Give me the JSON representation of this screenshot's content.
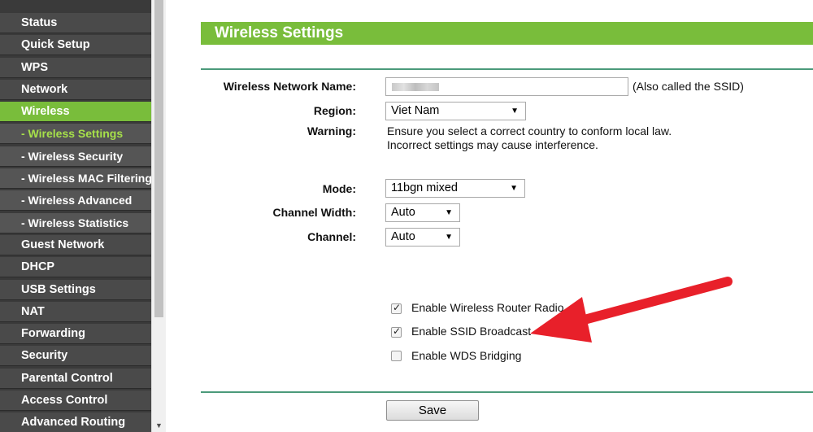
{
  "sidebar": {
    "items": [
      {
        "label": "Status"
      },
      {
        "label": "Quick Setup"
      },
      {
        "label": "WPS"
      },
      {
        "label": "Network"
      },
      {
        "label": "Wireless"
      },
      {
        "label": "- Wireless Settings"
      },
      {
        "label": "- Wireless Security"
      },
      {
        "label": "- Wireless MAC Filtering"
      },
      {
        "label": "- Wireless Advanced"
      },
      {
        "label": "- Wireless Statistics"
      },
      {
        "label": "Guest Network"
      },
      {
        "label": "DHCP"
      },
      {
        "label": "USB Settings"
      },
      {
        "label": "NAT"
      },
      {
        "label": "Forwarding"
      },
      {
        "label": "Security"
      },
      {
        "label": "Parental Control"
      },
      {
        "label": "Access Control"
      },
      {
        "label": "Advanced Routing"
      }
    ]
  },
  "page": {
    "title": "Wireless Settings"
  },
  "form": {
    "ssid_label": "Wireless Network Name:",
    "ssid_note": "(Also called the SSID)",
    "region_label": "Region:",
    "region_value": "Viet Nam",
    "warning_label": "Warning:",
    "warning_line1": "Ensure you select a correct country to conform local law.",
    "warning_line2": "Incorrect settings may cause interference.",
    "mode_label": "Mode:",
    "mode_value": "11bgn mixed",
    "channel_width_label": "Channel Width:",
    "channel_width_value": "Auto",
    "channel_label": "Channel:",
    "channel_value": "Auto",
    "checkboxes": [
      {
        "label": "Enable Wireless Router Radio",
        "checked": true
      },
      {
        "label": "Enable SSID Broadcast",
        "checked": true
      },
      {
        "label": "Enable WDS Bridging",
        "checked": false
      }
    ],
    "save_label": "Save"
  },
  "colors": {
    "accent_green": "#79bd3b",
    "active_subitem_text": "#a6e04a",
    "sidebar_bg": "#4a4a4a",
    "annotation_arrow": "#e8202a"
  },
  "icons": {
    "dropdown": "triangle-down",
    "checkbox_check": "check-mark",
    "scroll_down": "triangle-down"
  }
}
